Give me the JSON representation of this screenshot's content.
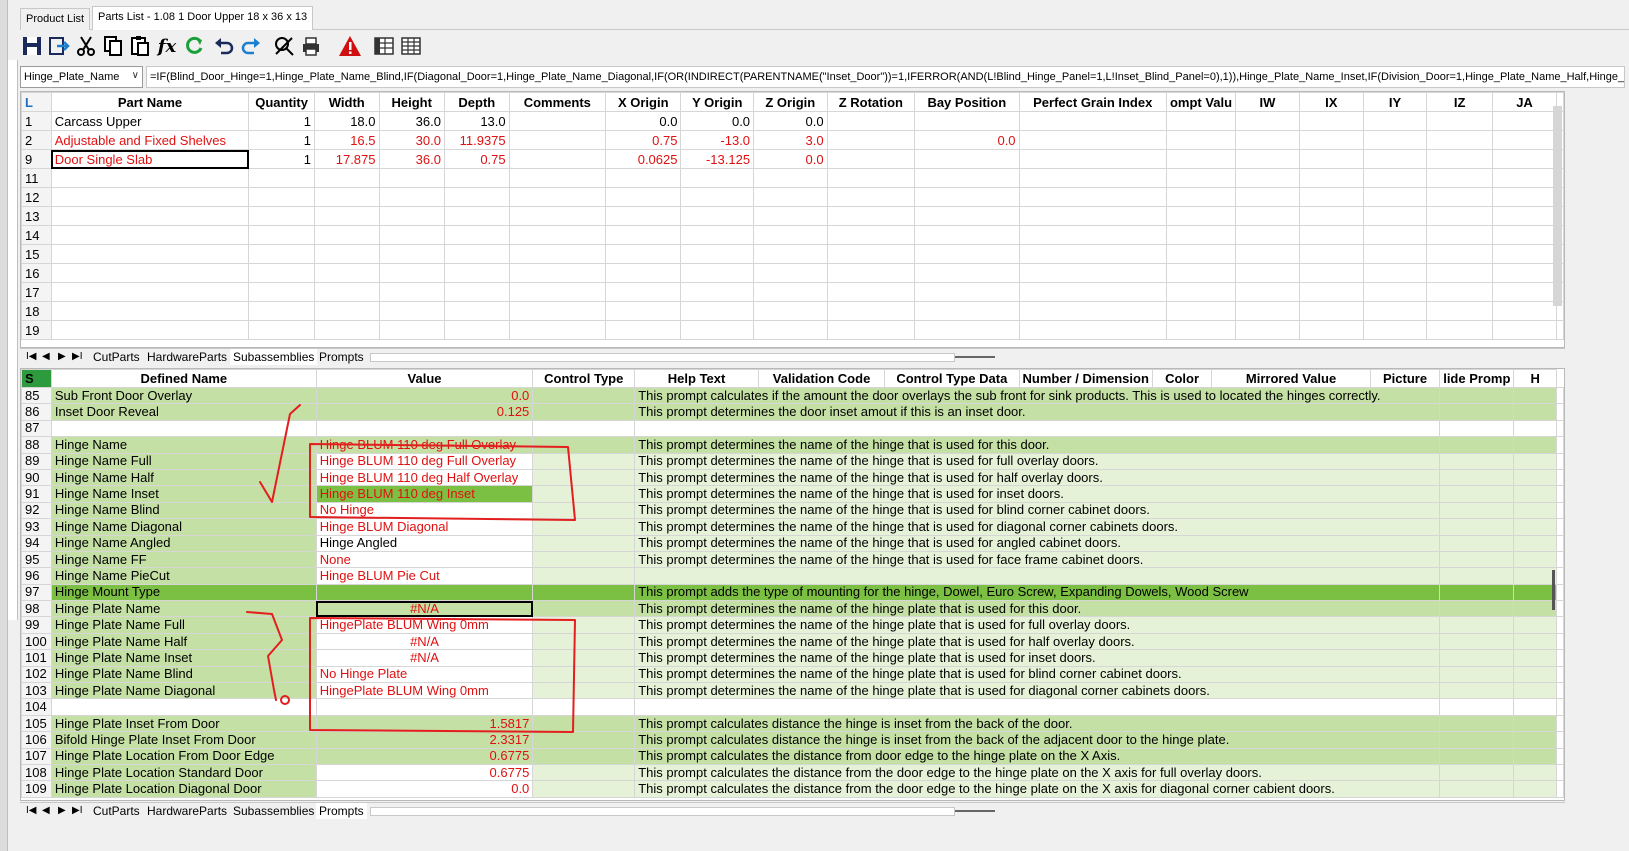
{
  "doc_tabs": [
    "Product List",
    "Parts List - 1.08 1 Door Upper 18 x 36 x 13"
  ],
  "toolbar": {
    "icons": [
      "save-icon",
      "export-icon",
      "cut-icon",
      "copy-icon",
      "paste-icon",
      "function-icon",
      "refresh-icon",
      "undo-icon",
      "redo-icon",
      "tools-icon",
      "print-icon",
      "warning-icon",
      "table-view-icon",
      "grid-view-icon"
    ],
    "function_glyph": "fx"
  },
  "formula_bar": {
    "name_box": "Hinge_Plate_Name",
    "formula": "=IF(Blind_Door_Hinge=1,Hinge_Plate_Name_Blind,IF(Diagonal_Door=1,Hinge_Plate_Name_Diagonal,IF(OR(INDIRECT(PARENTNAME(\"Inset_Door\"))=1,IFERROR(AND(L!Blind_Hinge_Panel=1,L!Inset_Blind_Panel=0),1)),Hinge_Plate_Name_Inset,IF(Division_Door=1,Hinge_Plate_Name_Half,Hinge_Plate_Nam"
  },
  "parts_grid": {
    "corner": "L",
    "columns": [
      "Part Name",
      "Quantity",
      "Width",
      "Height",
      "Depth",
      "Comments",
      "X Origin",
      "Y Origin",
      "Z Origin",
      "Z Rotation",
      "Bay Position",
      "Perfect Grain Index",
      "ompt Valu",
      "IW",
      "IX",
      "IY",
      "IZ",
      "JA"
    ],
    "rows": [
      {
        "n": "1",
        "name": "Carcass Upper",
        "qty": "1",
        "width": "18.0",
        "height": "36.0",
        "depth": "13.0",
        "comments": "",
        "x": "0.0",
        "y": "0.0",
        "z": "0.0",
        "zrot": "",
        "bay": "",
        "red": false
      },
      {
        "n": "2",
        "name": "Adjustable and Fixed Shelves",
        "qty": "1",
        "width": "16.5",
        "height": "30.0",
        "depth": "11.9375",
        "comments": "",
        "x": "0.75",
        "y": "-13.0",
        "z": "3.0",
        "zrot": "",
        "bay": "0.0",
        "red": true
      },
      {
        "n": "9",
        "name": "Door Single Slab",
        "qty": "1",
        "width": "17.875",
        "height": "36.0",
        "depth": "0.75",
        "comments": "",
        "x": "0.0625",
        "y": "-13.125",
        "z": "0.0",
        "zrot": "",
        "bay": "",
        "red": true
      },
      {
        "n": "11"
      },
      {
        "n": "12"
      },
      {
        "n": "13"
      },
      {
        "n": "14"
      },
      {
        "n": "15"
      },
      {
        "n": "16"
      },
      {
        "n": "17"
      },
      {
        "n": "18"
      },
      {
        "n": "19"
      }
    ]
  },
  "sheet_tabs": {
    "nav": [
      "I◀",
      "◀",
      "▶",
      "▶I"
    ],
    "top": [
      "CutParts",
      "HardwareParts",
      "Subassemblies",
      "Prompts"
    ],
    "top_active": "Subassemblies",
    "bottom": [
      "CutParts",
      "HardwareParts",
      "Subassemblies",
      "Prompts"
    ],
    "bottom_active": "Prompts"
  },
  "prompts_grid": {
    "corner": "S",
    "columns": [
      "Defined Name",
      "Value",
      "Control Type",
      "Help Text",
      "Validation Code",
      "Control Type Data",
      "Number / Dimension",
      "Color",
      "Mirrored Value",
      "Picture",
      "lide Promp",
      "H"
    ],
    "rows": [
      {
        "n": "85",
        "name": "Sub Front Door Overlay",
        "value": "0.0",
        "align": "right",
        "help": "This prompt calculates if the amount the door overlays the sub front for sink products. This is used to located the hinges correctly.",
        "style": "g"
      },
      {
        "n": "86",
        "name": "Inset Door Reveal",
        "value": "0.125",
        "align": "right",
        "help": "This prompt determines the door inset amout if this is an inset door.",
        "style": "g"
      },
      {
        "n": "87",
        "name": "",
        "value": "",
        "align": "left",
        "help": "",
        "style": "w"
      },
      {
        "n": "88",
        "name": "Hinge Name",
        "value": "Hinge BLUM 110 deg Full Overlay",
        "align": "left",
        "help": "This prompt determines the name of the hinge that is used for this door.",
        "style": "g"
      },
      {
        "n": "89",
        "name": "Hinge Name Full",
        "value": "Hinge BLUM 110 deg Full Overlay",
        "align": "left",
        "help": "This prompt determines the name of the hinge that is used for full overlay doors.",
        "style": "wg"
      },
      {
        "n": "90",
        "name": "Hinge Name Half",
        "value": "Hinge BLUM 110 deg Half Overlay",
        "align": "left",
        "help": "This prompt determines the name of the hinge that is used for half overlay doors.",
        "style": "wg"
      },
      {
        "n": "91",
        "name": "Hinge Name Inset",
        "value": "Hinge BLUM 110 deg Inset",
        "align": "left",
        "help": "This prompt determines the name of the hinge that is used for inset doors.",
        "style": "wg",
        "value_green": true
      },
      {
        "n": "92",
        "name": "Hinge Name Blind",
        "value": "No Hinge",
        "align": "left",
        "help": "This prompt determines the name of the hinge that is used for blind corner cabinet doors.",
        "style": "wg"
      },
      {
        "n": "93",
        "name": "Hinge Name Diagonal",
        "value": "Hinge BLUM Diagonal",
        "align": "left",
        "help": "This prompt determines the name of the hinge that is used for diagonal corner cabinets doors.",
        "style": "wg"
      },
      {
        "n": "94",
        "name": "Hinge Name Angled",
        "value": "Hinge Angled",
        "align": "left",
        "help": "This prompt determines the name of the hinge that is used for angled cabinet doors.",
        "style": "wg",
        "value_black": true
      },
      {
        "n": "95",
        "name": "Hinge Name FF",
        "value": "None",
        "align": "left",
        "help": "This prompt determines the name of the hinge that is used for face frame cabinet doors.",
        "style": "wg"
      },
      {
        "n": "96",
        "name": "Hinge Name PieCut",
        "value": "Hinge BLUM Pie Cut",
        "align": "left",
        "help": "",
        "style": "wg"
      },
      {
        "n": "97",
        "name": "Hinge Mount Type",
        "value": "",
        "align": "left",
        "help": "This prompt adds the type of mounting for the hinge, Dowel, Euro Screw, Expanding Dowels, Wood Screw",
        "style": "dg"
      },
      {
        "n": "98",
        "name": "Hinge Plate Name",
        "value": "#N/A",
        "align": "center",
        "help": "This prompt determines the name of the hinge plate that is used for this door.",
        "style": "g",
        "selected": true
      },
      {
        "n": "99",
        "name": "Hinge Plate Name Full",
        "value": "HingePlate BLUM Wing 0mm",
        "align": "left",
        "help": "This prompt determines the name of the hinge plate that is used for full overlay doors.",
        "style": "wg"
      },
      {
        "n": "100",
        "name": "Hinge Plate Name Half",
        "value": "#N/A",
        "align": "center",
        "help": "This prompt determines the name of the hinge plate that is used for half overlay doors.",
        "style": "wg"
      },
      {
        "n": "101",
        "name": "Hinge Plate Name Inset",
        "value": "#N/A",
        "align": "center",
        "help": "This prompt determines the name of the hinge plate that is used for inset doors.",
        "style": "wg"
      },
      {
        "n": "102",
        "name": "Hinge Plate Name Blind",
        "value": "No Hinge Plate",
        "align": "left",
        "help": "This prompt determines the name of the hinge plate that is used for blind corner cabinet doors.",
        "style": "wg"
      },
      {
        "n": "103",
        "name": "Hinge Plate Name Diagonal",
        "value": "HingePlate BLUM Wing 0mm",
        "align": "left",
        "help": "This prompt determines the name of the hinge plate that is used for diagonal corner cabinets doors.",
        "style": "wg"
      },
      {
        "n": "104",
        "name": "",
        "value": "",
        "align": "left",
        "help": "",
        "style": "w"
      },
      {
        "n": "105",
        "name": "Hinge Plate Inset From Door",
        "value": "1.5817",
        "align": "right",
        "help": "This prompt calculates distance the hinge is inset from the back of the door.",
        "style": "g"
      },
      {
        "n": "106",
        "name": "Bifold Hinge Plate Inset From Door",
        "value": "2.3317",
        "align": "right",
        "help": "This prompt calculates distance the hinge is inset from the back of the adjacent door to the hinge plate.",
        "style": "g"
      },
      {
        "n": "107",
        "name": "Hinge Plate Location From Door Edge",
        "value": "0.6775",
        "align": "right",
        "help": "This prompt calculates the distance from door edge to the hinge plate on the X Axis.",
        "style": "g"
      },
      {
        "n": "108",
        "name": "Hinge Plate Location Standard Door",
        "value": "0.6775",
        "align": "right",
        "help": "This prompt calculates the distance from the door edge to the hinge plate on the X axis for full overlay doors.",
        "style": "wg"
      },
      {
        "n": "109",
        "name": "Hinge Plate Location Diagonal Door",
        "value": "0.0",
        "align": "right",
        "help": "This prompt calculates the distance from the door edge to the hinge plate on the X axis for diagonal corner cabient doors.",
        "style": "wg"
      }
    ]
  },
  "colors": {
    "value_red": "#e01010",
    "row_green": "#c5e0a5",
    "row_dark_green": "#7cc043",
    "annotation_red": "#e41e1e"
  }
}
